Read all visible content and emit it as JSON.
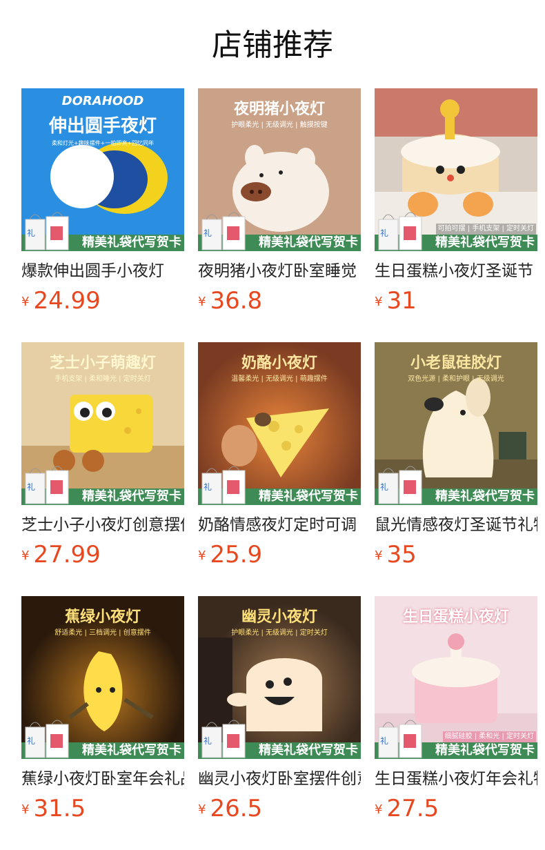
{
  "page": {
    "title": "店铺推荐"
  },
  "colors": {
    "price": "#e8481f",
    "banner": "#3e8b55"
  },
  "currency_symbol": "¥",
  "gift_banner": "精美礼袋代写贺卡",
  "gift_bag_char": "礼物",
  "products": [
    {
      "name": "爆款伸出圆手小夜灯",
      "price": "24.99",
      "image": {
        "brand": "DORAHOOD",
        "headline": "伸出圆手夜灯",
        "subline": "柔和灯光+趣味摆件+一拍即亮+回忆同年",
        "icon": "round-hand-lamp-icon"
      }
    },
    {
      "name": "夜明猪小夜灯卧室睡觉",
      "price": "36.8",
      "image": {
        "headline": "夜明猪小夜灯",
        "subline": "护眼柔光 | 无级调光 | 触摸按键",
        "icon": "pig-lamp-icon"
      }
    },
    {
      "name": "生日蛋糕小夜灯圣诞节",
      "price": "31",
      "image": {
        "feature_strip": "可拍可摆 | 手机支架 | 定时关灯",
        "icon": "cake-character-lamp-icon"
      }
    },
    {
      "name": "芝士小子小夜灯创意摆件",
      "price": "27.99",
      "image": {
        "headline": "芝士小子萌趣灯",
        "subline": "手机支架 | 柔和睡光 | 定时关灯",
        "icon": "cheese-character-lamp-icon"
      }
    },
    {
      "name": "奶酪情感夜灯定时可调",
      "price": "25.9",
      "image": {
        "headline": "奶酪小夜灯",
        "subline": "温馨柔光 | 无级调光 | 萌趣摆件",
        "icon": "cheese-lamp-icon"
      }
    },
    {
      "name": "鼠光情感夜灯圣诞节礼物",
      "price": "35",
      "image": {
        "headline": "小老鼠硅胶灯",
        "subline": "双色光源 | 柔和护眼 | 无级调光",
        "icon": "mouse-lamp-icon"
      }
    },
    {
      "name": "蕉绿小夜灯卧室年会礼品",
      "price": "31.5",
      "image": {
        "headline": "蕉绿小夜灯",
        "subline": "舒适柔光 | 三档调光 | 创意摆件",
        "icon": "banana-lamp-icon"
      }
    },
    {
      "name": "幽灵小夜灯卧室摆件创意",
      "price": "26.5",
      "image": {
        "headline": "幽灵小夜灯",
        "subline": "护眼柔光 | 无级调光 | 定时关灯",
        "icon": "ghost-lamp-icon"
      }
    },
    {
      "name": "生日蛋糕小夜灯年会礼物",
      "price": "27.5",
      "image": {
        "headline": "生日蛋糕小夜灯",
        "feature_strip": "细腻硅胶 | 柔和光 | 定时关灯",
        "icon": "birthday-cake-lamp-icon"
      }
    }
  ]
}
